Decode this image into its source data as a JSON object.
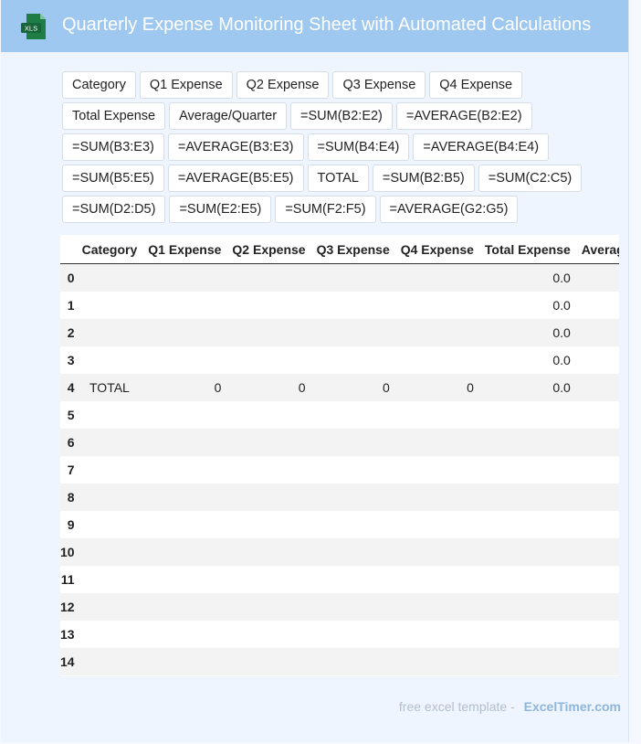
{
  "header": {
    "icon_label": "XLS",
    "title": "Quarterly Expense Monitoring Sheet with Automated Calculations"
  },
  "chips": [
    "Category",
    "Q1 Expense",
    "Q2 Expense",
    "Q3 Expense",
    "Q4 Expense",
    "Total Expense",
    "Average/Quarter",
    "=SUM(B2:E2)",
    "=AVERAGE(B2:E2)",
    "=SUM(B3:E3)",
    "=AVERAGE(B3:E3)",
    "=SUM(B4:E4)",
    "=AVERAGE(B4:E4)",
    "=SUM(B5:E5)",
    "=AVERAGE(B5:E5)",
    "TOTAL",
    "=SUM(B2:B5)",
    "=SUM(C2:C5)",
    "=SUM(D2:D5)",
    "=SUM(E2:E5)",
    "=SUM(F2:F5)",
    "=AVERAGE(G2:G5)"
  ],
  "table": {
    "columns": [
      "",
      "Category",
      "Q1 Expense",
      "Q2 Expense",
      "Q3 Expense",
      "Q4 Expense",
      "Total Expense",
      "Average/Quarter"
    ],
    "rows": [
      [
        "0",
        "",
        "",
        "",
        "",
        "",
        "0.0",
        ""
      ],
      [
        "1",
        "",
        "",
        "",
        "",
        "",
        "0.0",
        ""
      ],
      [
        "2",
        "",
        "",
        "",
        "",
        "",
        "0.0",
        ""
      ],
      [
        "3",
        "",
        "",
        "",
        "",
        "",
        "0.0",
        ""
      ],
      [
        "4",
        "TOTAL",
        "0",
        "0",
        "0",
        "0",
        "0.0",
        ""
      ],
      [
        "5",
        "",
        "",
        "",
        "",
        "",
        "",
        ""
      ],
      [
        "6",
        "",
        "",
        "",
        "",
        "",
        "",
        ""
      ],
      [
        "7",
        "",
        "",
        "",
        "",
        "",
        "",
        ""
      ],
      [
        "8",
        "",
        "",
        "",
        "",
        "",
        "",
        ""
      ],
      [
        "9",
        "",
        "",
        "",
        "",
        "",
        "",
        ""
      ],
      [
        "10",
        "",
        "",
        "",
        "",
        "",
        "",
        ""
      ],
      [
        "11",
        "",
        "",
        "",
        "",
        "",
        "",
        ""
      ],
      [
        "12",
        "",
        "",
        "",
        "",
        "",
        "",
        ""
      ],
      [
        "13",
        "",
        "",
        "",
        "",
        "",
        "",
        ""
      ],
      [
        "14",
        "",
        "",
        "",
        "",
        "",
        "",
        ""
      ]
    ]
  },
  "footer": {
    "prefix": "free excel template -",
    "brand": "ExcelTimer.com"
  },
  "colors": {
    "header_bg": "#9ec8f0",
    "icon_green": "#1e7d45",
    "footer_brand": "#8eb6dd"
  }
}
